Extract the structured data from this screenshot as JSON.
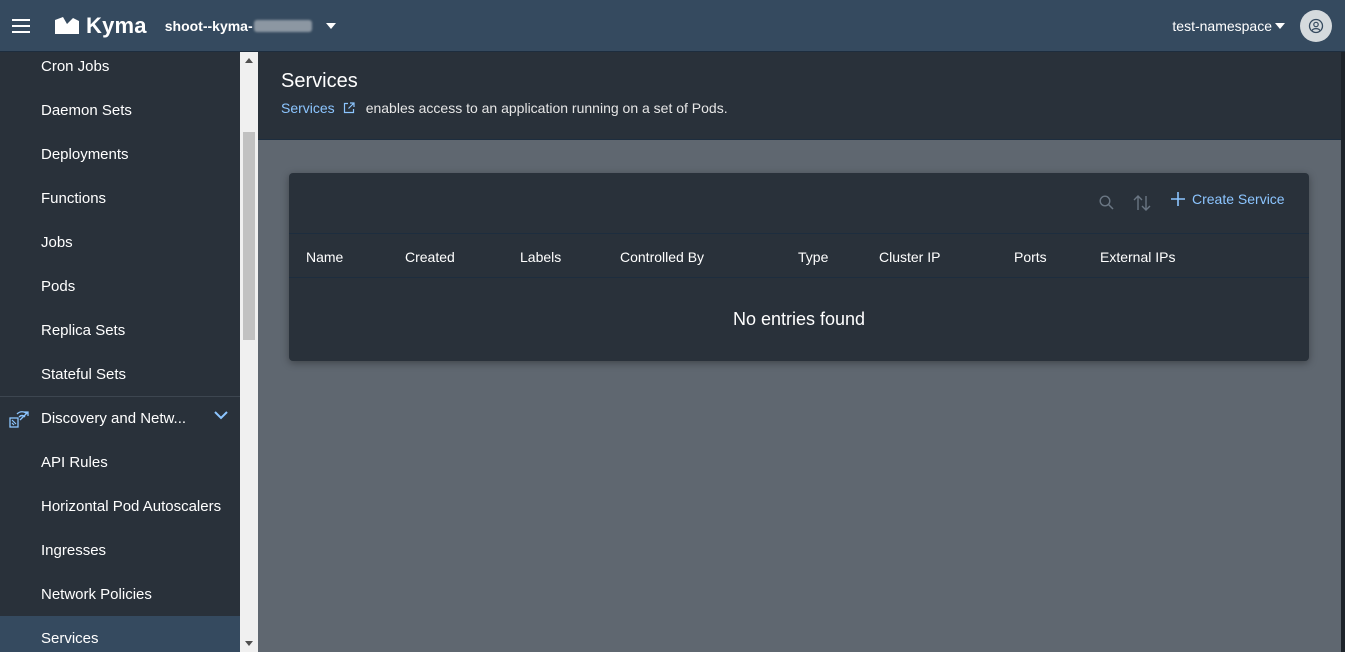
{
  "shellbar": {
    "logo_text": "Kyma",
    "cluster_name": "shoot--kyma-",
    "namespace": "test-namespace"
  },
  "sidebar": {
    "items": [
      {
        "label": "Cron Jobs"
      },
      {
        "label": "Daemon Sets"
      },
      {
        "label": "Deployments"
      },
      {
        "label": "Functions"
      },
      {
        "label": "Jobs"
      },
      {
        "label": "Pods"
      },
      {
        "label": "Replica Sets"
      },
      {
        "label": "Stateful Sets"
      }
    ],
    "group": {
      "label": "Discovery and Netw..."
    },
    "group_items": [
      {
        "label": "API Rules"
      },
      {
        "label": "Horizontal Pod Autoscalers"
      },
      {
        "label": "Ingresses"
      },
      {
        "label": "Network Policies"
      },
      {
        "label": "Services"
      }
    ]
  },
  "page": {
    "title": "Services",
    "link_text": "Services",
    "description": "enables access to an application running on a set of Pods."
  },
  "table": {
    "create_label": "Create Service",
    "columns": [
      "Name",
      "Created",
      "Labels",
      "Controlled By",
      "Type",
      "Cluster IP",
      "Ports",
      "External IPs"
    ],
    "empty_text": "No entries found"
  },
  "colors": {
    "shellbar_bg": "#354a5f",
    "sidebar_bg": "#29313a",
    "link": "#8cc5ff",
    "content_bg": "#5f6770"
  }
}
